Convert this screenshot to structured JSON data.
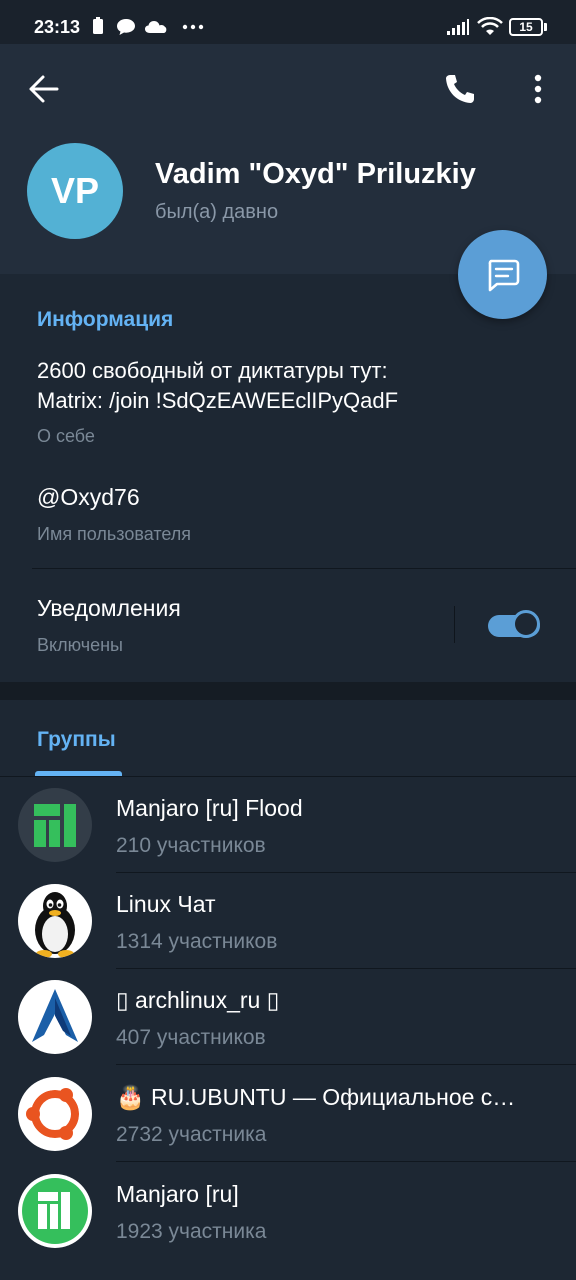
{
  "status_bar": {
    "time": "23:13",
    "battery": "15",
    "icons": [
      "battery-icon",
      "chat-bubble-icon",
      "cloud-icon",
      "more-dots-icon",
      "signal-icon",
      "wifi-icon"
    ]
  },
  "header": {
    "avatar_initials": "VP",
    "name": "Vadim \"Oxyd\" Priluzkiy",
    "last_seen": "был(а) давно",
    "icons": [
      "back-arrow-icon",
      "phone-icon",
      "kebab-menu-icon",
      "message-icon"
    ]
  },
  "info": {
    "title": "Информация",
    "bio_line1": "2600 свободный от диктатуры тут:",
    "bio_line2": "Matrix: /join !SdQzEAWEEclIPyQadF",
    "bio_caption": "О себе",
    "username": "@Oxyd76",
    "username_caption": "Имя пользователя",
    "notifications_label": "Уведомления",
    "notifications_status": "Включены",
    "notifications_enabled": true
  },
  "groups": {
    "tab_label": "Группы",
    "items": [
      {
        "title": "Manjaro [ru] Flood",
        "members": "210 участников",
        "avatar": "manjaro-logo-icon"
      },
      {
        "title": "Linux Чат",
        "members": "1314 участников",
        "avatar": "tux-penguin-icon"
      },
      {
        "title": "▯ archlinux_ru ▯",
        "members": "407 участников",
        "avatar": "arch-logo-icon"
      },
      {
        "title": "🎂 RU.UBUNTU — Официальное с…",
        "members": "2732 участника",
        "avatar": "ubuntu-logo-icon"
      },
      {
        "title": "Manjaro [ru]",
        "members": "1923 участника",
        "avatar": "manjaro-ru-logo-icon"
      }
    ]
  },
  "colors": {
    "accent": "#64b3f4",
    "header_bg": "#232e3c",
    "body_bg": "#1d2733",
    "avatar_bg": "#53b1d4",
    "fab": "#5b9ed6"
  }
}
